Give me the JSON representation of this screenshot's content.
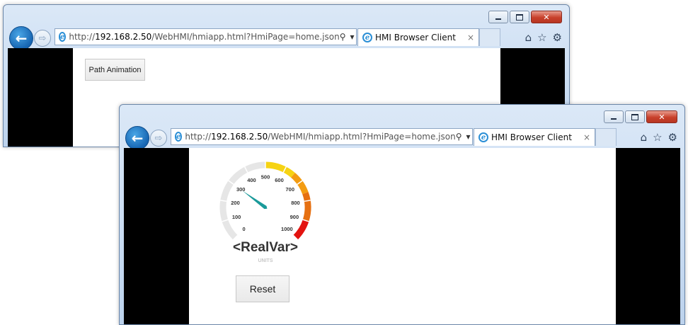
{
  "browser": {
    "url_prefix": "http://",
    "url_host": "192.168.2.50",
    "url_path": "/WebHMI/hmiapp.html?HmiPage=home.json",
    "tab_title": "HMI Browser Client",
    "ie_glyph": "e",
    "search_glyph": "⚲",
    "dropdown_glyph": "▾",
    "refresh_glyph": "↻",
    "close_tab_glyph": "×",
    "home_glyph": "⌂",
    "favorites_glyph": "☆",
    "settings_glyph": "⚙",
    "back_glyph": "←",
    "forward_glyph": "⇨",
    "minimize_icon": "minimize-icon",
    "maximize_icon": "maximize-icon",
    "close_glyph": "✕"
  },
  "back_window": {
    "button_label": "Path Animation"
  },
  "front_window": {
    "gauge": {
      "variable_label": "<RealVar>",
      "units_label": "UNITS",
      "min": 0,
      "max": 1000,
      "value": 300,
      "ticks": [
        "0",
        "100",
        "200",
        "300",
        "400",
        "500",
        "600",
        "700",
        "800",
        "900",
        "1000"
      ],
      "colors": {
        "track": "#e6e6e6",
        "yellow": "#f6d313",
        "orange": "#f39c12",
        "dark_orange": "#e67011",
        "red": "#e3130f",
        "needle": "#1a9a9a"
      }
    },
    "reset_label": "Reset"
  }
}
